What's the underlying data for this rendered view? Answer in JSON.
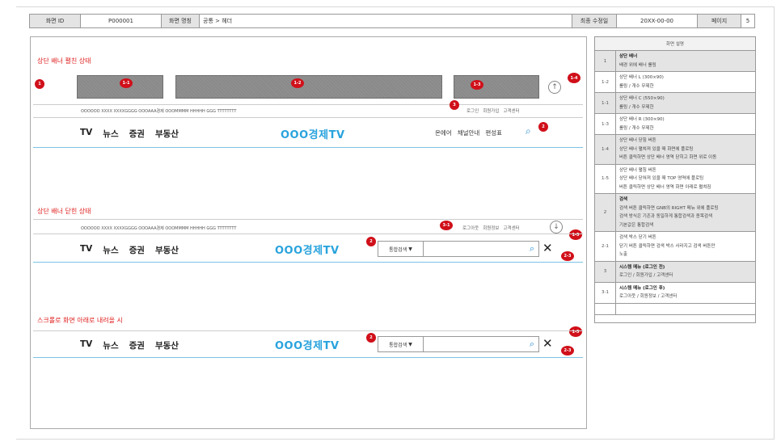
{
  "info": {
    "screen_id_label": "화면 ID",
    "screen_id": "P000001",
    "screen_name_label": "화면 명칭",
    "screen_name": "공통 > 헤더",
    "modified_label": "최종 수정일",
    "modified": "20XX-00-00",
    "page_label": "페이지",
    "page": "5"
  },
  "section1": {
    "title": "상단 배너 펼친 상태",
    "badges": {
      "b1": "1",
      "b11": "1-1",
      "b12": "1-2",
      "b13": "1-3",
      "b14": "1-4",
      "b3": "3",
      "b2": "2"
    },
    "up_icon": "↑",
    "util_text": "OOOOOO XXXX XXXXGGGG OOOAAA경제 OOOMMMM HHHHH GGG TTTTTTTT",
    "util_links": [
      "로그인",
      "회원가입",
      "고객센터"
    ],
    "gnb": [
      "TV",
      "뉴스",
      "증권",
      "부동산"
    ],
    "logo": "OOO경제TV",
    "right_menu": [
      "온에어",
      "채널안내",
      "편성표"
    ]
  },
  "section2": {
    "title": "상단 배너 닫힌 상태",
    "badges": {
      "b31": "3-1",
      "b15": "1-5",
      "b2": "2",
      "b23": "2-3"
    },
    "down_icon": "↓",
    "util_text": "OOOOOO XXXX XXXXGGGG OOOAAA경제 OOOMMMM HHHHH GGG TTTTTTTT",
    "util_links": [
      "로그아웃",
      "회원정보",
      "고객센터"
    ],
    "gnb": [
      "TV",
      "뉴스",
      "증권",
      "부동산"
    ],
    "logo": "OOO경제TV",
    "search_select": "통합검색",
    "close_icon": "✕"
  },
  "section3": {
    "title": "스크롤로 화면 아래로 내려올 시",
    "badges": {
      "b15": "1-5",
      "b2": "2",
      "b23": "2-3"
    },
    "gnb": [
      "TV",
      "뉴스",
      "증권",
      "부동산"
    ],
    "logo": "OOO경제TV",
    "search_select": "통합검색",
    "close_icon": "✕"
  },
  "desc": {
    "header": "화면 설명",
    "rows": [
      {
        "num": "1",
        "title": "상단 배너",
        "lines": [
          "배경 위에 배너 롤링"
        ]
      },
      {
        "num": "1-2",
        "title": "",
        "lines": [
          "상단 배너 L (300×90)",
          "롤링 / 개수 무제한"
        ]
      },
      {
        "num": "1-1",
        "title": "",
        "lines": [
          "상단 배너 C (550×90)",
          "롤링 / 개수 무제한"
        ]
      },
      {
        "num": "1-3",
        "title": "",
        "lines": [
          "상단 배너 R (300×90)",
          "롤링 / 개수 무제한"
        ]
      },
      {
        "num": "1-4",
        "title": "",
        "lines": [
          "상단 배너 닫힘 버튼",
          "상단 배너 펼쳐져 있을 때 화면에 플로팅",
          "버튼 클릭하면 상단 배너 영역 닫히고 화면 위로 이동"
        ]
      },
      {
        "num": "1-5",
        "title": "",
        "lines": [
          "상단 배너 펼침 버튼",
          "상단 배너 닫혀져 있을 때 TOP 영역에 플로팅",
          "버튼 클릭하면 상단 배너 영역 화면 아래로 펼쳐짐"
        ]
      },
      {
        "num": "2",
        "title": "검색",
        "lines": [
          "검색 버튼 클릭하면 GNB의 RIGHT 메뉴 위에 플로팅",
          "검색 방식은 기존과 동일하게 통합검색과 종목검색",
          "기본값은 통합검색"
        ]
      },
      {
        "num": "2-1",
        "title": "",
        "lines": [
          "검색 박스 닫기 버튼",
          "닫기 버튼 클릭하면 검색 박스 사라지고 검색 버튼만",
          "노출"
        ]
      },
      {
        "num": "3",
        "title": "시스템 메뉴 (로그인 전)",
        "lines": [
          "로그인 / 회원가입 / 고객센터"
        ]
      },
      {
        "num": "3-1",
        "title": "시스템 메뉴 (로그인 후)",
        "lines": [
          "로그아웃 / 회원정보 / 고객센터"
        ]
      }
    ]
  }
}
